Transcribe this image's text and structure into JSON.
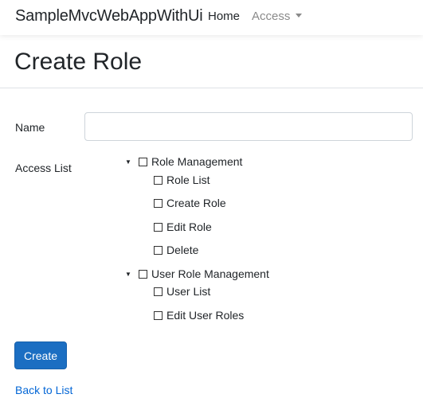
{
  "navbar": {
    "brand": "SampleMvcWebAppWithUi",
    "links": [
      {
        "label": "Home"
      },
      {
        "label": "Access",
        "has_dropdown": true
      }
    ]
  },
  "page": {
    "title": "Create Role"
  },
  "form": {
    "name_label": "Name",
    "name_value": "",
    "name_placeholder": "",
    "access_list_label": "Access List",
    "access_tree": [
      {
        "label": "Role Management",
        "expanded": true,
        "checked": false,
        "children": [
          {
            "label": "Role List",
            "checked": false
          },
          {
            "label": "Create Role",
            "checked": false
          },
          {
            "label": "Edit Role",
            "checked": false
          },
          {
            "label": "Delete",
            "checked": false
          }
        ]
      },
      {
        "label": "User Role Management",
        "expanded": true,
        "checked": false,
        "children": [
          {
            "label": "User List",
            "checked": false
          },
          {
            "label": "Edit User Roles",
            "checked": false
          }
        ]
      }
    ],
    "submit_label": "Create"
  },
  "footer": {
    "back_link": "Back to List"
  },
  "colors": {
    "primary": "#1b6ec2",
    "link": "#0366d6",
    "muted_nav": "#8a8a8a",
    "text": "#212529"
  },
  "icons": {
    "tree_toggle": "triangle-down-icon",
    "checkbox": "checkbox-unchecked-icon",
    "dropdown": "caret-down-icon"
  }
}
